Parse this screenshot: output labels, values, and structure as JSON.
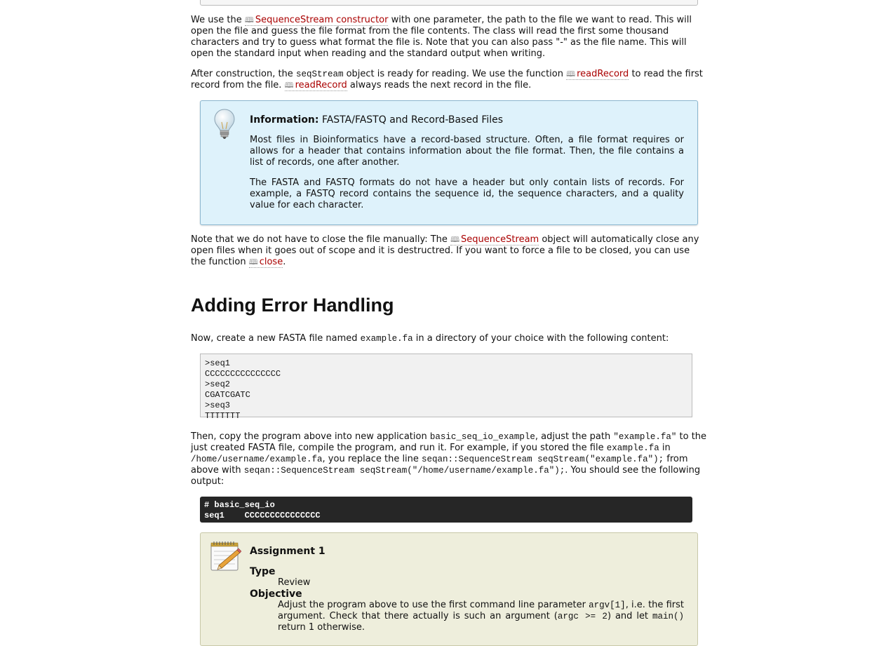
{
  "p1": {
    "t1": "We use the ",
    "link": "SequenceStream constructor",
    "t2": " with one parameter, the path to the file we want to read. This will open the file and guess the file format from the file contents. The class will read the first some thousand characters and try to guess what format the file is. Note that you can also pass \"-\" as the file name. This will open the standard input when reading and the standard output when writing."
  },
  "p2": {
    "t1": "After construction, the ",
    "code1": "seqStream",
    "t2": " object is ready for reading. We use the function ",
    "link1": "readRecord",
    "t3": " to read the first record from the file. ",
    "link2": "readRecord",
    "t4": " always reads the next record in the file."
  },
  "info": {
    "title": "Information:",
    "subtitle": "FASTA/FASTQ and Record-Based Files",
    "para1": "Most files in Bioinformatics have a record-based structure. Often, a file format requires or allows for a header that contains information about the file format. Then, the file contains a list of records, one after another.",
    "para2": "The FASTA and FASTQ formats do not have a header but only contain lists of records. For example, a FASTQ record contains the sequence id, the sequence characters, and a quality value for each character."
  },
  "p3": {
    "t1": "Note that we do not have to close the file manually: The ",
    "link1": "SequenceStream",
    "t2": " object will automatically close any open files when it goes out of scope and it is destructred. If you want to force a file to be closed, you can use the function ",
    "link2": "close",
    "t3": "."
  },
  "heading": "Adding Error Handling",
  "p4": {
    "t1": "Now, create a new FASTA file named ",
    "code1": "example.fa",
    "t2": " in a directory of your choice with the following content:"
  },
  "fasta": ">seq1\nCCCCCCCCCCCCCCC\n>seq2\nCGATCGATC\n>seq3\nTTTTTTT",
  "p5": {
    "t1": "Then, copy the program above into new application ",
    "code1": "basic_seq_io_example",
    "t2": ", adjust the path ",
    "code2": "\"example.fa\"",
    "t3": " to the just created FASTA file, compile the program, and run it. For example, if you stored the file ",
    "code3": "example.fa",
    "t4": " in ",
    "code4": "/home/username/example.fa",
    "t5": ", you replace the line ",
    "code5": "seqan::SequenceStream seqStream(\"example.fa\");",
    "t6": " from above with ",
    "code6": "seqan::SequenceStream seqStream(\"/home/username/example.fa\");",
    "t7": ". You should see the following output:"
  },
  "terminal": "# basic_seq_io\nseq1    CCCCCCCCCCCCCCC",
  "assignment": {
    "title": "Assignment 1",
    "type_label": "Type",
    "type_value": "Review",
    "objective_label": "Objective",
    "obj_t1": "Adjust the program above to use the first command line parameter ",
    "obj_code1": "argv[1]",
    "obj_t2": ", i.e. the first argument. Check that there actually is such an argument (",
    "obj_code2": "argc >= 2",
    "obj_t3": ") and let ",
    "obj_code3": "main()",
    "obj_t4": " return 1 otherwise."
  }
}
